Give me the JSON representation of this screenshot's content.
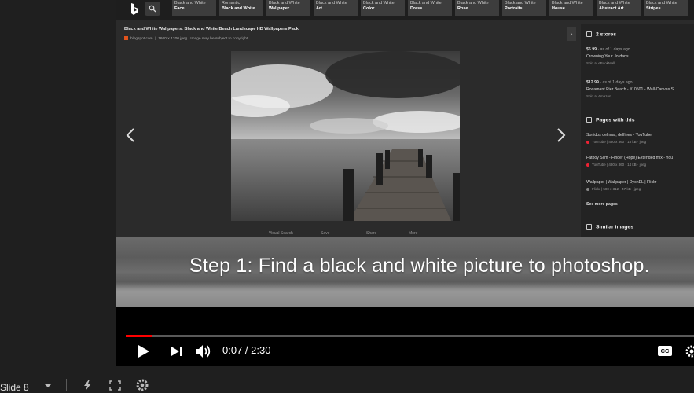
{
  "colors": {
    "accent_red": "#ff0000",
    "bing_blue": "#ffffff"
  },
  "bing": {
    "chips": [
      {
        "l1": "Black and White",
        "l2": "Face"
      },
      {
        "l1": "Romantic",
        "l2": "Black and White"
      },
      {
        "l1": "Black and White",
        "l2": "Wallpaper"
      },
      {
        "l1": "Black and White",
        "l2": "Art"
      },
      {
        "l1": "Black and White",
        "l2": "Color"
      },
      {
        "l1": "Black and White",
        "l2": "Dress"
      },
      {
        "l1": "Black and White",
        "l2": "Rose"
      },
      {
        "l1": "Black and White",
        "l2": "Portraits"
      },
      {
        "l1": "Black and White",
        "l2": "House"
      },
      {
        "l1": "Black and White",
        "l2": "Abstract Art"
      },
      {
        "l1": "Black and White",
        "l2": "Stripes"
      }
    ],
    "image_title": "Black and White Wallpapers: Black and White Beach Landscape HD Wallpapers Pack",
    "image_source": "blogspot.com",
    "image_info": "1600 × 1200 jpeg  |  Image may be subject to copyright.",
    "actions": [
      "Visual Search",
      "Save",
      "Share",
      "More"
    ],
    "panel": {
      "stores_heading": "2 stores",
      "store1_price": "$6.99",
      "store1_age": "· as of 1 days ago",
      "store1_name": "Crowning Your Jordans",
      "store1_sold": "Sold at eBookMall",
      "store2_price": "$12.99",
      "store2_age": "· as of 1 days ago",
      "store2_name": "Rocamant Pier Beach - #10501 - Wall-Canvas S",
      "store2_sold": "Sold at Amazon",
      "pages_heading": "Pages with this",
      "page1_title": "Sonidos del mar, delfines - YouTube",
      "page1_meta": "YouTube | 480 x 360 · 18 kB · jpeg",
      "page2_title": "Fatboy Slim - Finder (Hope) Extended mix - You",
      "page2_meta": "YouTube | 480 x 360 · 14 kB · jpeg",
      "page3_title": "Wallpaper | Wallpaper | DycnEL | Flickr",
      "page3_meta": "Flickr | 500 x 312 · 47 kB · jpeg",
      "see_more": "See more pages",
      "similar_heading": "Similar images"
    }
  },
  "caption": "Step 1: Find a black and white picture to photoshop.",
  "player": {
    "time": "0:07 / 2:30",
    "progress_percent": 4.7,
    "cc_label": "CC"
  },
  "bottom_bar": {
    "slide_label": "Slide 8"
  }
}
